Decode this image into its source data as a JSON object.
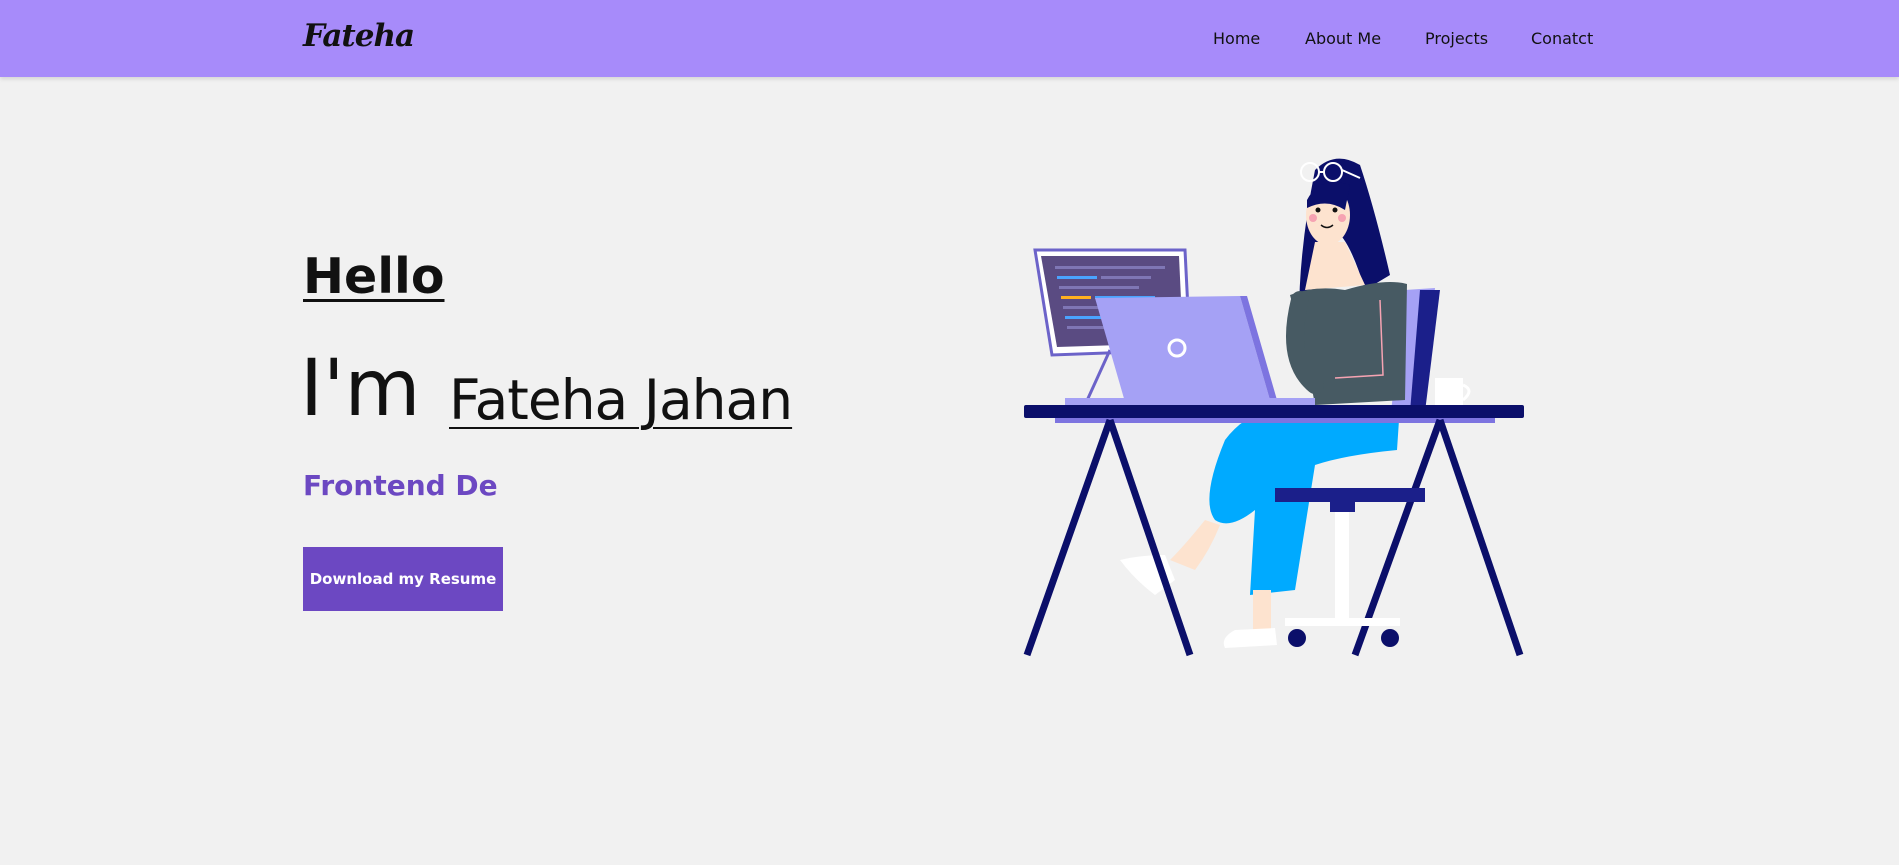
{
  "header": {
    "brand": "Fateha",
    "nav": {
      "home": "Home",
      "about": "About Me",
      "projects": "Projects",
      "contact": "Conatct"
    }
  },
  "hero": {
    "greeting": "Hello",
    "intro": "I'm",
    "name": "Fateha Jahan",
    "role": "Frontend De",
    "resume_button": "Download my Resume"
  },
  "illustration": {
    "name": "woman-working-at-laptop-illustration"
  },
  "colors": {
    "navbar_bg": "#a78bfa",
    "page_bg": "#f1f1f1",
    "accent": "#6c48c2",
    "desk": "#0b0f6a",
    "laptop": "#a5a1f5",
    "pants": "#00aaff",
    "top": "#475a63"
  }
}
